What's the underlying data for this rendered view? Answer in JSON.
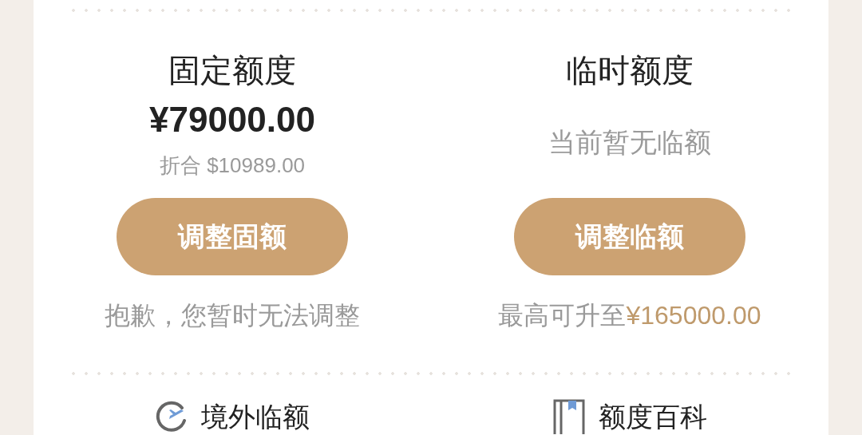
{
  "quotas": [
    {
      "title": "固定额度",
      "amount": "¥79000.00",
      "converted": "折合 $10989.00",
      "button": "调整固额",
      "note": "抱歉，您暂时无法调整"
    },
    {
      "title": "临时额度",
      "status": "当前暂无临额",
      "button": "调整临额",
      "note": "最高可升至",
      "note_amount": "¥165000.00"
    }
  ],
  "links": [
    {
      "kind": "clock",
      "label": "境外临额"
    },
    {
      "kind": "book",
      "label": "额度百科"
    }
  ]
}
